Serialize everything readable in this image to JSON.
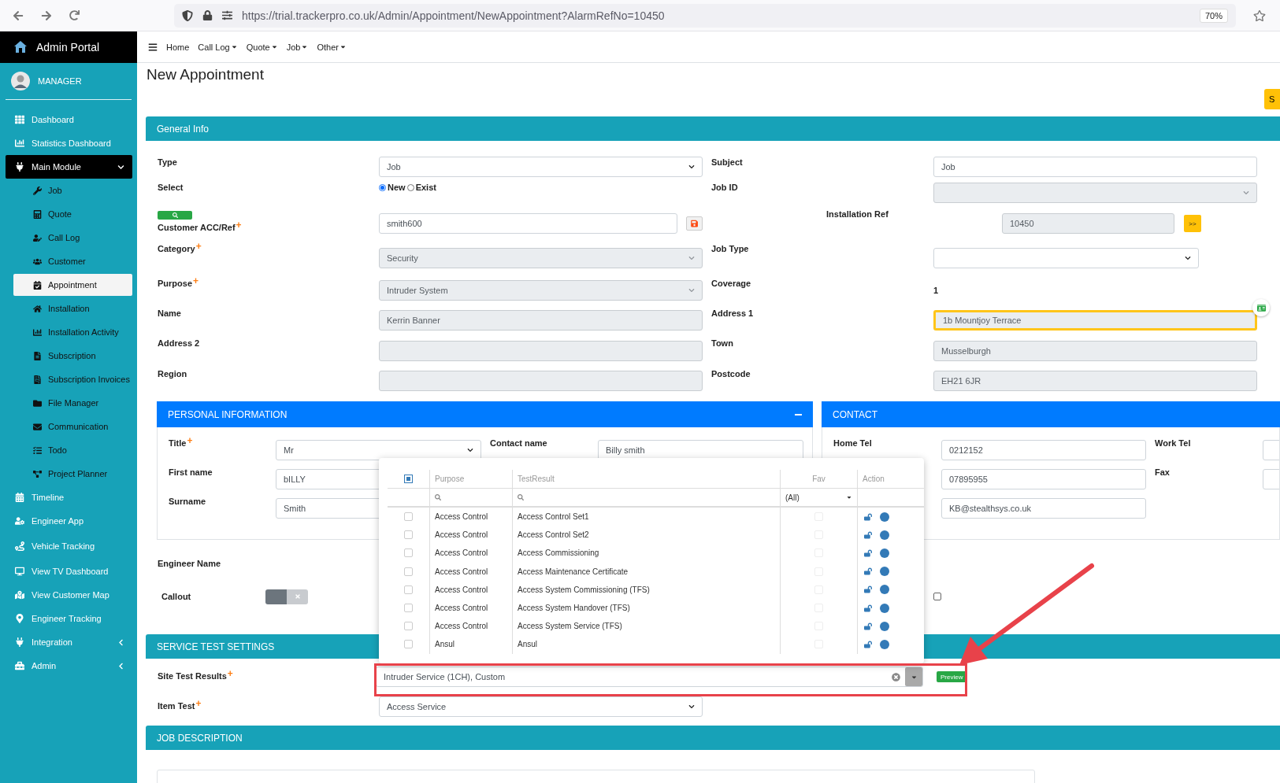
{
  "browser": {
    "url": "https://trial.trackerpro.co.uk/Admin/Appointment/NewAppointment?AlarmRefNo=10450",
    "zoom": "70%"
  },
  "sidebar": {
    "brand": "Admin Portal",
    "user": "MANAGER",
    "items": [
      {
        "label": "Dashboard",
        "kind": "link",
        "selected": false
      },
      {
        "label": "Statistics Dashboard",
        "kind": "link",
        "selected": false
      },
      {
        "label": "Main Module",
        "kind": "group",
        "expanded": true,
        "selected": true,
        "children": [
          {
            "label": "Job",
            "selected": false
          },
          {
            "label": "Quote",
            "selected": false
          },
          {
            "label": "Call Log",
            "selected": false
          },
          {
            "label": "Customer",
            "selected": false
          },
          {
            "label": "Appointment",
            "selected": true
          },
          {
            "label": "Installation",
            "selected": false
          },
          {
            "label": "Installation Activity",
            "selected": false
          },
          {
            "label": "Subscription",
            "selected": false
          },
          {
            "label": "Subscription Invoices",
            "selected": false
          },
          {
            "label": "File Manager",
            "selected": false
          },
          {
            "label": "Communication",
            "selected": false
          },
          {
            "label": "Todo",
            "selected": false
          },
          {
            "label": "Project Planner",
            "selected": false
          }
        ]
      },
      {
        "label": "Timeline",
        "kind": "link",
        "selected": false
      },
      {
        "label": "Engineer App",
        "kind": "link",
        "selected": false
      },
      {
        "label": "Vehicle Tracking",
        "kind": "link",
        "selected": false
      },
      {
        "label": "View TV Dashboard",
        "kind": "link",
        "selected": false
      },
      {
        "label": "View Customer Map",
        "kind": "link",
        "selected": false
      },
      {
        "label": "Engineer Tracking",
        "kind": "link",
        "selected": false
      },
      {
        "label": "Integration",
        "kind": "group",
        "expanded": false,
        "selected": false
      },
      {
        "label": "Admin",
        "kind": "group",
        "expanded": false,
        "selected": false
      }
    ]
  },
  "navbar": [
    {
      "label": "Home",
      "dropdown": false
    },
    {
      "label": "Call Log",
      "dropdown": true
    },
    {
      "label": "Quote",
      "dropdown": true
    },
    {
      "label": "Job",
      "dropdown": true
    },
    {
      "label": "Other",
      "dropdown": true
    }
  ],
  "page": {
    "title": "New Appointment",
    "corner_button": "S"
  },
  "general_info": {
    "title": "General Info",
    "rows": [
      {
        "left": {
          "label": "Type",
          "kind": "select",
          "value": "Job",
          "disabled": false
        },
        "right": {
          "label": "Subject",
          "kind": "input",
          "value": "Job",
          "disabled": false
        }
      },
      {
        "left": {
          "label": "Select",
          "kind": "radio",
          "options": [
            {
              "label": "New",
              "selected": true
            },
            {
              "label": "Exist",
              "selected": false
            }
          ]
        },
        "right": {
          "label": "Job ID",
          "kind": "select",
          "disabled": true
        }
      },
      {
        "left": {
          "label": "Customer ACC/Ref",
          "required_mark": "+",
          "kind": "customer",
          "value": "smith600",
          "disabled": false
        },
        "right": {
          "label": "Installation Ref",
          "kind": "ref",
          "value": "10450",
          "disabled": true,
          "button": ">>"
        }
      },
      {
        "left": {
          "label": "Category",
          "required_mark": "+",
          "kind": "select",
          "value": "Security",
          "disabled": true
        },
        "right": {
          "label": "Job Type",
          "kind": "select",
          "disabled": false
        }
      },
      {
        "left": {
          "label": "Purpose",
          "required_mark": "+",
          "kind": "select",
          "value": "Intruder System",
          "disabled": true
        },
        "right": {
          "label": "Coverage",
          "kind": "text",
          "value": "1"
        }
      },
      {
        "left": {
          "label": "Name",
          "kind": "input",
          "value": "Kerrin Banner",
          "disabled": true
        },
        "right": {
          "label": "Address 1",
          "kind": "input",
          "value": "1b Mountjoy Terrace",
          "disabled": true,
          "highlighted": true
        }
      },
      {
        "left": {
          "label": "Address 2",
          "kind": "input",
          "disabled": true
        },
        "right": {
          "label": "Town",
          "kind": "input",
          "value": "Musselburgh",
          "disabled": true
        }
      },
      {
        "left": {
          "label": "Region",
          "kind": "input",
          "disabled": true
        },
        "right": {
          "label": "Postcode",
          "kind": "input",
          "value": "EH21 6JR",
          "disabled": true
        }
      }
    ]
  },
  "personal": {
    "title": "PERSONAL INFORMATION",
    "expanded": true,
    "rows": [
      {
        "left": {
          "label": "Title",
          "required_mark": "+",
          "kind": "select",
          "value": "Mr",
          "disabled": false
        },
        "right": {
          "label": "Contact name",
          "kind": "input",
          "value": "Billy smith",
          "disabled": false
        }
      },
      {
        "left": {
          "label": "First name",
          "kind": "input",
          "value": "bILLY",
          "disabled": false
        }
      },
      {
        "left": {
          "label": "Surname",
          "kind": "input",
          "value": "Smith",
          "disabled": false
        }
      }
    ]
  },
  "contact": {
    "title": "CONTACT",
    "rows": [
      {
        "left": {
          "label": "Home Tel",
          "kind": "input",
          "value": "0212152",
          "disabled": false
        },
        "right": {
          "label": "Work Tel",
          "kind": "input",
          "disabled": false
        }
      },
      {
        "left": {
          "kind": "input",
          "value": "07895955",
          "disabled": false
        },
        "right": {
          "label": "Fax",
          "kind": "input",
          "disabled": false
        }
      },
      {
        "left": {
          "kind": "input",
          "value": "KB@stealthsys.co.uk",
          "disabled": false
        }
      }
    ]
  },
  "engineer": {
    "label": "Engineer Name"
  },
  "callout": {
    "label": "Callout",
    "on": false
  },
  "extra_checkbox": {
    "checked": false
  },
  "service_test": {
    "title": "SERVICE TEST SETTINGS",
    "site_test": {
      "label": "Site Test Results",
      "required_mark": "+",
      "value": "Intruder Service (1CH), Custom",
      "button": "Preview"
    },
    "item_test": {
      "label": "Item Test",
      "required_mark": "+",
      "value": "Access Service"
    }
  },
  "job_description": {
    "title": "JOB DESCRIPTION"
  },
  "popup": {
    "partially_selected": true,
    "columns": [
      "Purpose",
      "TestResult",
      "Fav",
      "Action"
    ],
    "fav_filter": "(All)",
    "rows": [
      {
        "purpose": "Access Control",
        "test_result": "Access Control Set1",
        "checked": false,
        "favorite": false
      },
      {
        "purpose": "Access Control",
        "test_result": "Access Control Set2",
        "checked": false,
        "favorite": false
      },
      {
        "purpose": "Access Control",
        "test_result": "Access Commissioning",
        "checked": false,
        "favorite": false
      },
      {
        "purpose": "Access Control",
        "test_result": "Access Maintenance Certificate",
        "checked": false,
        "favorite": false
      },
      {
        "purpose": "Access Control",
        "test_result": "Access System Commissioning (TFS)",
        "checked": false,
        "favorite": false
      },
      {
        "purpose": "Access Control",
        "test_result": "Access System Handover (TFS)",
        "checked": false,
        "favorite": false
      },
      {
        "purpose": "Access Control",
        "test_result": "Access System Service (TFS)",
        "checked": false,
        "favorite": false
      },
      {
        "purpose": "Ansul",
        "test_result": "Ansul",
        "checked": false,
        "favorite": false
      }
    ]
  }
}
